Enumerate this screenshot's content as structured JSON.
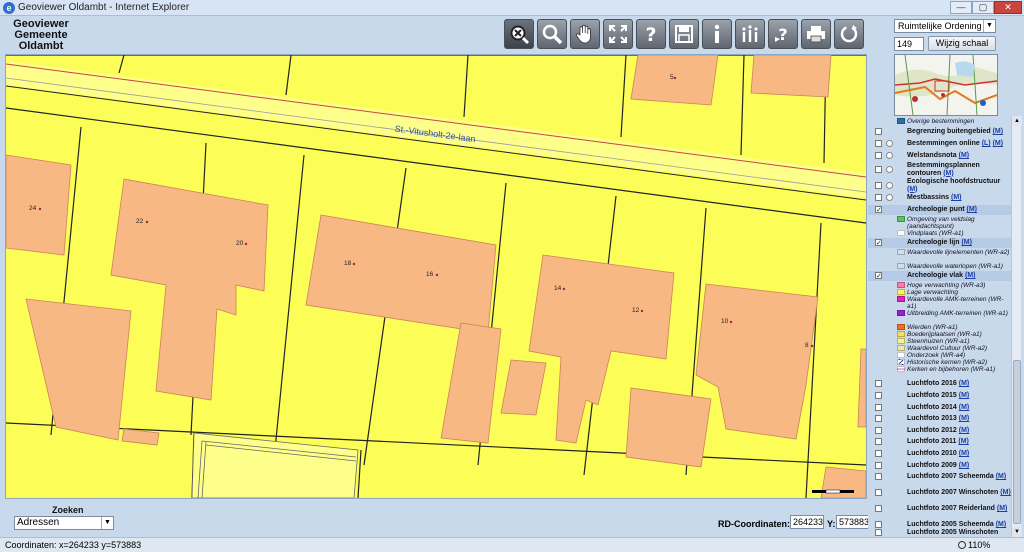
{
  "window": {
    "title": "Geoviewer Oldambt - Internet Explorer",
    "minimize": "—",
    "maximize": "▢",
    "close": "✕"
  },
  "app": {
    "name_line1": "Geoviewer",
    "name_line2": "Gemeente",
    "name_line3": "Oldambt"
  },
  "toolbar": [
    {
      "name": "zoom-out-tool",
      "icon": "zoom-out-icon"
    },
    {
      "name": "zoom-in-tool",
      "icon": "magnifier-icon"
    },
    {
      "name": "pan-tool",
      "icon": "hand-icon"
    },
    {
      "name": "full-extent-tool",
      "icon": "extent-icon"
    },
    {
      "name": "help-tool",
      "icon": "question-icon"
    },
    {
      "name": "save-tool",
      "icon": "floppy-icon"
    },
    {
      "name": "info-tool",
      "icon": "info-icon"
    },
    {
      "name": "multi-info-tool",
      "icon": "multi-info-icon"
    },
    {
      "name": "query-help-tool",
      "icon": "question-bubble-icon"
    },
    {
      "name": "print-tool",
      "icon": "printer-icon"
    },
    {
      "name": "refresh-tool",
      "icon": "refresh-icon"
    }
  ],
  "theme_select": {
    "value": "Ruimtelijke Ordening"
  },
  "scale": {
    "value": "149",
    "button": "Wijzig schaal"
  },
  "map": {
    "street_label": "St.-Vitusholt-2e-laan",
    "house_numbers": [
      "24",
      "22",
      "20",
      "18",
      "16",
      "14",
      "12",
      "10",
      "8",
      "5"
    ],
    "colors": {
      "parcel": "#fdfd58",
      "building": "#f8b884",
      "road": "#ffffff"
    }
  },
  "layers": {
    "overige_legend": "Overige bestemmingen",
    "begrenzing": "Begrenzing buitengebied",
    "bestemmingen_online": "Bestemmingen online",
    "welstandsnota": "Welstandsnota",
    "bestemmingsplannen": "Bestemmingsplannen contouren",
    "ecologische": "Ecologische hoofdstructuur",
    "mestbassins": "Mestbassins",
    "arch_punt": "Archeologie punt",
    "arch_punt_legend": [
      "Omgeving van veldslag (aandachtspunt)",
      "Vindplaats (WR-a1)"
    ],
    "arch_lijn": "Archeologie lijn",
    "arch_lijn_legend": [
      "Waardevolle lijnelementen (WR-a2)",
      "Waardevolle waterlopen (WR-a1)"
    ],
    "arch_vlak": "Archeologie vlak",
    "arch_vlak_legend": [
      "Hoge verwachting (WR-a3)",
      "Lage verwachting",
      "Waardevolle AMK-terreinen (WR-a1)",
      "Uitbreiding AMK-terreinen (WR-a1)",
      "Wierden (WR-a1)",
      "Boederijplaatsen (WR-a1)",
      "Steenhuizen (WR-a1)",
      "Waardevol Cultuur (WR-a2)",
      "Onderzoek (WR-a4)",
      "Historische kernen (WR-a2)",
      "Kerken en bijbehoren (WR-a1)"
    ],
    "luchtfoto": [
      "Luchtfoto 2016",
      "Luchtfoto 2015",
      "Luchtfoto 2014",
      "Luchtfoto 2013",
      "Luchtfoto 2012",
      "Luchtfoto 2011",
      "Luchtfoto 2010",
      "Luchtfoto 2009",
      "Luchtfoto 2007 Scheemda",
      "Luchtfoto 2007 Winschoten",
      "Luchtfoto 2007 Reiderland",
      "Luchtfoto 2005 Scheemda",
      "Luchtfoto 2005 Winschoten"
    ],
    "link_m": "(M)",
    "link_l": "(L)"
  },
  "bottom": {
    "search_label": "Zoeken",
    "search_value": "Adressen",
    "rd_label": "RD-Coordinaten: X:",
    "rd_x": "264233",
    "y_label": "Y:",
    "rd_y": "573883"
  },
  "status": {
    "text": "Coordinaten: x=264233  y=573883",
    "zoom": "110%"
  }
}
